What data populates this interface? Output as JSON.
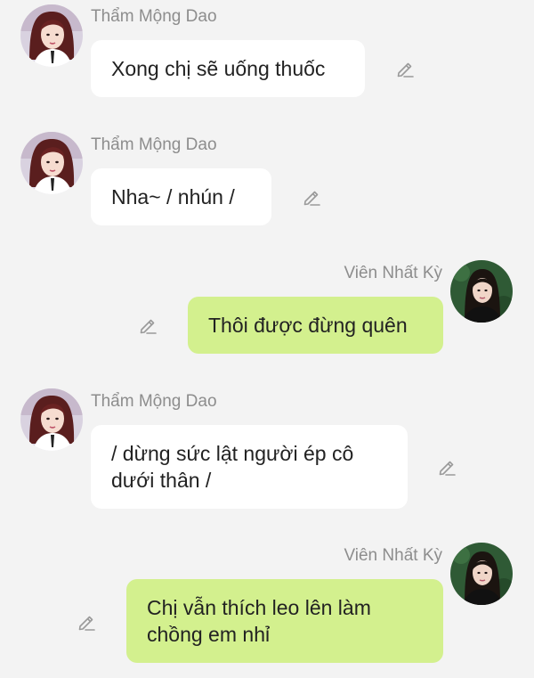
{
  "messages": [
    {
      "sender": "Thẩm Mộng Dao",
      "text": "Xong chị sẽ uống thuốc",
      "side": "left",
      "avatar": "avatar-red-hair-icon",
      "action_icon": "edit-icon"
    },
    {
      "sender": "Thẩm Mộng Dao",
      "text": "Nha~ / nhún /",
      "side": "left",
      "avatar": "avatar-red-hair-icon",
      "action_icon": "edit-icon"
    },
    {
      "sender": "Viên Nhất Kỳ",
      "text": "Thôi được đừng quên",
      "side": "right",
      "avatar": "avatar-dark-hair-icon",
      "action_icon": "edit-icon"
    },
    {
      "sender": "Thẩm Mộng Dao",
      "text": "/ dừng sức lật người ép cô dưới thân /",
      "side": "left",
      "avatar": "avatar-red-hair-icon",
      "action_icon": "edit-icon"
    },
    {
      "sender": "Viên Nhất Kỳ",
      "text": "Chị vẫn thích leo lên làm chồng em nhỉ",
      "side": "right",
      "avatar": "avatar-dark-hair-icon",
      "action_icon": "edit-icon"
    }
  ],
  "colors": {
    "background": "#f3f3f3",
    "incoming_bubble": "#ffffff",
    "outgoing_bubble": "#d3f08e",
    "sender_name": "#8d8d8d",
    "text": "#222222",
    "icon": "#9a9a9a"
  }
}
